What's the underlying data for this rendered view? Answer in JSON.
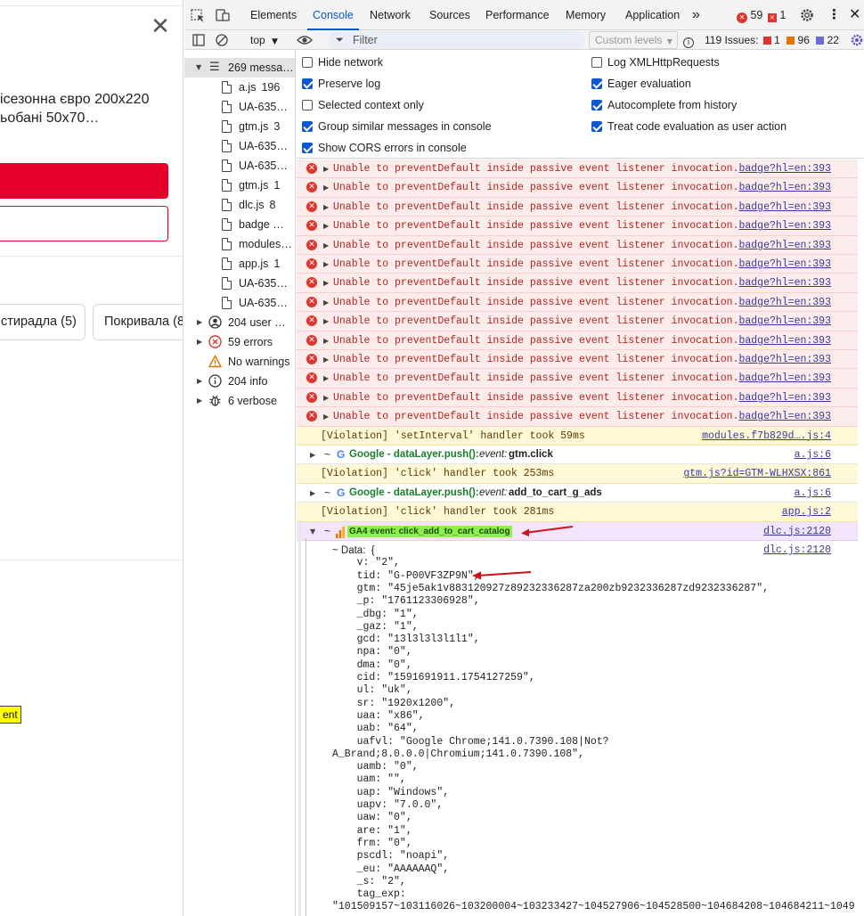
{
  "page": {
    "product_title_line1": "ісезонна євро 200x220",
    "product_title_line2": "ьобані 50x70…",
    "chip1_label": "стирадла (5)",
    "chip2_label": "Покривала (8",
    "badge_text": "ent"
  },
  "devtools": {
    "tabs": [
      "Elements",
      "Console",
      "Network",
      "Sources",
      "Performance",
      "Memory",
      "Application"
    ],
    "active_tab": "Console",
    "tab_more": "»",
    "error_count": "59",
    "issue_count_small": "1",
    "toolbar": {
      "context": "top",
      "filter_placeholder": "Filter",
      "levels": "Custom levels",
      "issues_label": "119 Issues:",
      "issues_err": "1",
      "issues_warn": "96",
      "issues_info": "22"
    },
    "sidebar": [
      {
        "label": "269 messa…",
        "count": "",
        "kind": "list",
        "expanded": true,
        "selected": true
      },
      {
        "label": "a.js",
        "count": "196",
        "kind": "file"
      },
      {
        "label": "UA-635…",
        "count": "",
        "kind": "file"
      },
      {
        "label": "gtm.js",
        "count": "3",
        "kind": "file"
      },
      {
        "label": "UA-635…",
        "count": "",
        "kind": "file"
      },
      {
        "label": "UA-635…",
        "count": "",
        "kind": "file"
      },
      {
        "label": "gtm.js",
        "count": "1",
        "kind": "file"
      },
      {
        "label": "dlc.js",
        "count": "8",
        "kind": "file"
      },
      {
        "label": "badge …",
        "count": "",
        "kind": "file"
      },
      {
        "label": "modules…",
        "count": "",
        "kind": "file"
      },
      {
        "label": "app.js",
        "count": "1",
        "kind": "file"
      },
      {
        "label": "UA-635…",
        "count": "",
        "kind": "file"
      },
      {
        "label": "UA-635…",
        "count": "",
        "kind": "file"
      },
      {
        "label": "204 user …",
        "count": "",
        "kind": "user"
      },
      {
        "label": "59 errors",
        "count": "",
        "kind": "errors"
      },
      {
        "label": "No warnings",
        "count": "",
        "kind": "warnings"
      },
      {
        "label": "204 info",
        "count": "",
        "kind": "info"
      },
      {
        "label": "6 verbose",
        "count": "",
        "kind": "verbose"
      }
    ],
    "settings": {
      "left": [
        {
          "label": "Hide network",
          "checked": false
        },
        {
          "label": "Preserve log",
          "checked": true
        },
        {
          "label": "Selected context only",
          "checked": false
        },
        {
          "label": "Group similar messages in console",
          "checked": true
        },
        {
          "label": "Show CORS errors in console",
          "checked": true
        }
      ],
      "right": [
        {
          "label": "Log XMLHttpRequests",
          "checked": false
        },
        {
          "label": "Eager evaluation",
          "checked": true
        },
        {
          "label": "Autocomplete from history",
          "checked": true
        },
        {
          "label": "Treat code evaluation as user action",
          "checked": true
        }
      ]
    },
    "console": {
      "error_message": "Unable to preventDefault inside passive event listener invocation.",
      "error_source": "badge?hl=en:393",
      "error_rows": 14,
      "rows": [
        {
          "type": "warn",
          "text": "[Violation] 'setInterval' handler took 59ms",
          "source": "modules.f7b829d….js:4"
        },
        {
          "type": "group",
          "prefix": "Google - dataLayer.push():",
          "event_label": "event:",
          "event": "gtm.click",
          "source": "a.js:6"
        },
        {
          "type": "warn",
          "text": "[Violation] 'click' handler took 253ms",
          "source": "gtm.js?id=GTM-WLHXSX:861"
        },
        {
          "type": "group",
          "prefix": "Google - dataLayer.push():",
          "event_label": "event:",
          "event": "add_to_cart_g_ads",
          "source": "a.js:6"
        },
        {
          "type": "warn",
          "text": "[Violation] 'click' handler took 281ms",
          "source": "app.js:2"
        },
        {
          "type": "ga4",
          "text": "GA4 event: click_add_to_cart_catalog",
          "source": "dlc.js:2120"
        }
      ],
      "data_header": "~ Data:  {",
      "data_source": "dlc.js:2120",
      "data_lines": [
        "    v: \"2\",",
        "    tid: \"G-P00VF3ZP9N\",",
        "    gtm: \"45je5ak1v883120927z89232336287za200zb9232336287zd9232336287\",",
        "    _p: \"1761123306928\",",
        "    _dbg: \"1\",",
        "    _gaz: \"1\",",
        "    gcd: \"13l3l3l3l1l1\",",
        "    npa: \"0\",",
        "    dma: \"0\",",
        "    cid: \"1591691911.1754127259\",",
        "    ul: \"uk\",",
        "    sr: \"1920x1200\",",
        "    uaa: \"x86\",",
        "    uab: \"64\",",
        "    uafvl: \"Google Chrome;141.0.7390.108|Not?",
        "A_Brand;8.0.0.0|Chromium;141.0.7390.108\",",
        "    uamb: \"0\",",
        "    uam: \"\",",
        "    uap: \"Windows\",",
        "    uapv: \"7.0.0\",",
        "    uaw: \"0\",",
        "    are: \"1\",",
        "    frm: \"0\",",
        "    pscdl: \"noapi\",",
        "    _eu: \"AAAAAAQ\",",
        "    _s: \"2\",",
        "    tag_exp:",
        "\"101509157~103116026~103200004~103233427~104527906~104528500~104684208~104684211~1049"
      ]
    }
  },
  "colors": {
    "accent": "#0b57d0",
    "error": "#dc362e",
    "brand_red": "#e4002b",
    "annotation_arrow": "#d0101a"
  }
}
